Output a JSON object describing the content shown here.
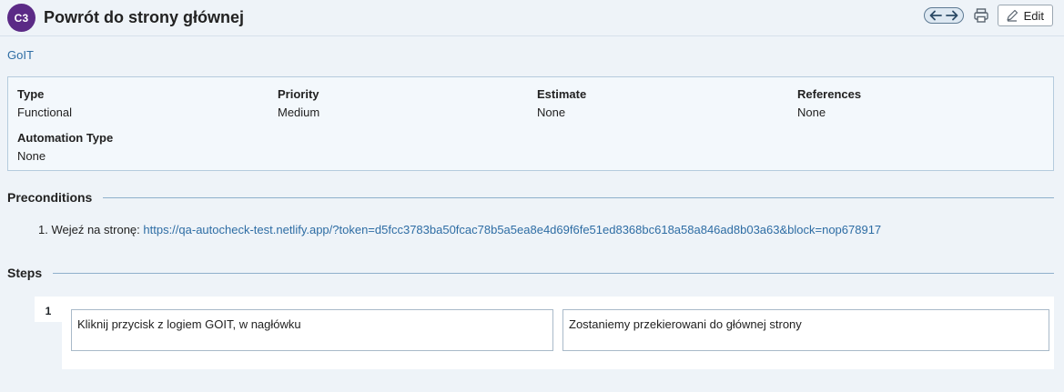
{
  "header": {
    "case_id": "C3",
    "title": "Powrót do strony głównej",
    "edit_label": "Edit",
    "icons": {
      "prev": "arrow-left-icon",
      "next": "arrow-right-icon",
      "print": "printer-icon",
      "edit": "pencil-icon"
    }
  },
  "project": {
    "name": "GoIT"
  },
  "properties": {
    "type": {
      "label": "Type",
      "value": "Functional"
    },
    "priority": {
      "label": "Priority",
      "value": "Medium"
    },
    "estimate": {
      "label": "Estimate",
      "value": "None"
    },
    "references": {
      "label": "References",
      "value": "None"
    },
    "automation_type": {
      "label": "Automation Type",
      "value": "None"
    }
  },
  "preconditions": {
    "heading": "Preconditions",
    "items": [
      {
        "prefix": "1. Wejeź na stronę:",
        "link": "https://qa-autocheck-test.netlify.app/?token=d5fcc3783ba50fcac78b5a5ea8e4d69f6fe51ed8368bc618a58a846ad8b03a63&block=nop678917"
      }
    ]
  },
  "steps": {
    "heading": "Steps",
    "items": [
      {
        "number": "1",
        "action": "Kliknij przycisk z logiem GOIT, w nagłówku",
        "expected": "Zostaniemy przekierowani do głównej strony"
      }
    ]
  },
  "colors": {
    "badge": "#5b2a86",
    "link": "#2e6da4",
    "background": "#eef3f8"
  }
}
